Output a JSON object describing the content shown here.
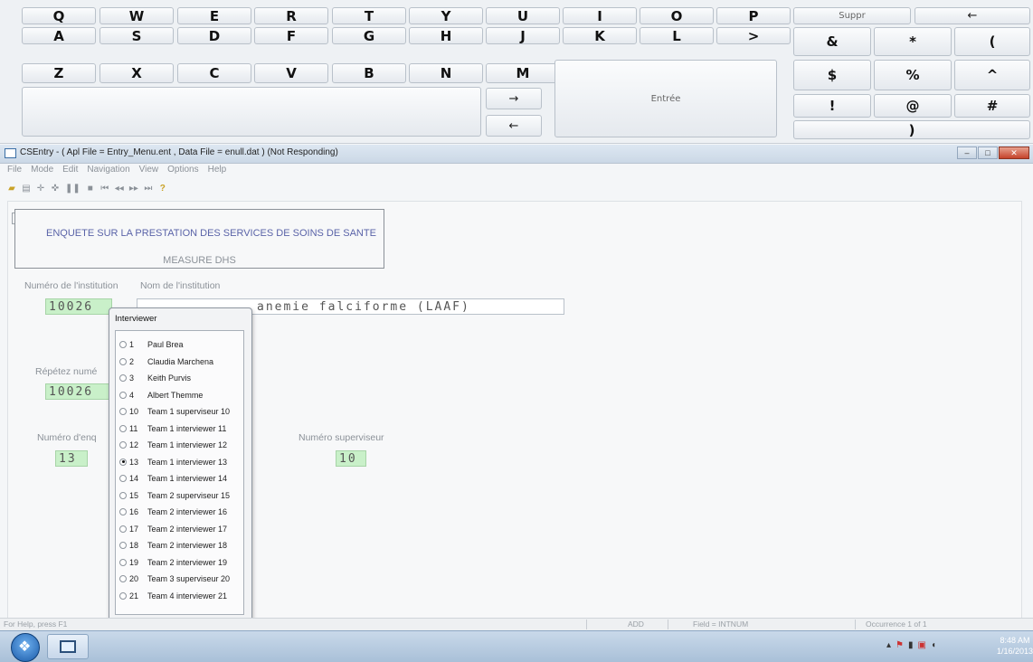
{
  "keyboard": {
    "row1": [
      "Q",
      "W",
      "E",
      "R",
      "T",
      "Y",
      "U",
      "I",
      "O",
      "P"
    ],
    "row2": [
      "A",
      "S",
      "D",
      "F",
      "G",
      "H",
      "J",
      "K",
      "L",
      ">"
    ],
    "row3": [
      "Z",
      "X",
      "C",
      "V",
      "B",
      "N",
      "M"
    ],
    "arrow_right": "→",
    "arrow_left": "←",
    "enter_label": "Entrée",
    "delete_label": "Suppr",
    "backspace": "←",
    "symbols_row1": [
      "&",
      "*",
      "("
    ],
    "symbols_row2": [
      "$",
      "%",
      "^"
    ],
    "symbols_row3": [
      "!",
      "@",
      "#"
    ],
    "symbols_row4": ")"
  },
  "window": {
    "title": "CSEntry - ( Apl File = Entry_Menu.ent , Data File = enull.dat ) (Not Responding)",
    "menu": [
      "File",
      "Mode",
      "Edit",
      "Navigation",
      "View",
      "Options",
      "Help"
    ]
  },
  "form": {
    "survey_title": "ENQUETE SUR LA PRESTATION DES SERVICES DE SOINS DE SANTE",
    "survey_subtitle": "MEASURE DHS",
    "institution_number_label": "Numéro de l'institution",
    "institution_name_label": "Nom de l'institution",
    "institution_number_value": "10026",
    "institution_name_value": "anemie falciforme (LAAF)",
    "repeat_number_label": "Répétez numé",
    "repeat_number_value": "10026",
    "interviewer_number_label": "Numéro d'enq",
    "interviewer_number_value": "13",
    "supervisor_number_label": "Numéro superviseur",
    "supervisor_number_value": "10"
  },
  "dialog": {
    "title": "Interviewer",
    "selected": "13",
    "options": [
      {
        "num": "1",
        "name": "Paul Brea"
      },
      {
        "num": "2",
        "name": "Claudia Marchena"
      },
      {
        "num": "3",
        "name": "Keith Purvis"
      },
      {
        "num": "4",
        "name": "Albert Themme"
      },
      {
        "num": "10",
        "name": "Team 1 superviseur 10"
      },
      {
        "num": "11",
        "name": "Team 1 interviewer 11"
      },
      {
        "num": "12",
        "name": "Team 1 interviewer 12"
      },
      {
        "num": "13",
        "name": "Team 1 interviewer 13"
      },
      {
        "num": "14",
        "name": "Team 1 interviewer 14"
      },
      {
        "num": "15",
        "name": "Team 2 superviseur 15"
      },
      {
        "num": "16",
        "name": "Team 2 interviewer 16"
      },
      {
        "num": "17",
        "name": "Team 2 interviewer 17"
      },
      {
        "num": "18",
        "name": "Team 2 interviewer 18"
      },
      {
        "num": "19",
        "name": "Team 2 interviewer 19"
      },
      {
        "num": "20",
        "name": "Team 3 superviseur 20"
      },
      {
        "num": "21",
        "name": "Team 4 interviewer 21"
      }
    ]
  },
  "statusbar": {
    "help": "For Help, press F1",
    "mode": "ADD",
    "field": "Field = INTNUM",
    "occurrence": "Occurrence 1 of 1"
  },
  "taskbar": {
    "time": "8:48 AM",
    "date": "1/16/2013"
  }
}
